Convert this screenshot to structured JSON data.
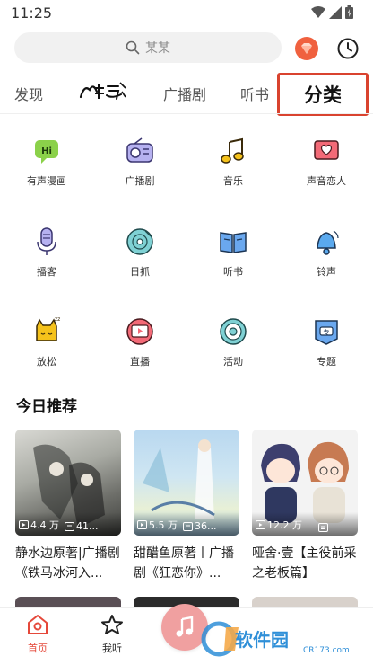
{
  "status_bar": {
    "time": "11:25"
  },
  "header": {
    "search_placeholder": "某某",
    "icons": [
      "search-icon",
      "vip-gem-icon",
      "history-clock-icon"
    ]
  },
  "tabs": [
    {
      "label": "发现"
    },
    {
      "label": "情绘",
      "is_logo": true
    },
    {
      "label": "广播剧"
    },
    {
      "label": "听书"
    },
    {
      "label": "分类",
      "active": true
    }
  ],
  "categories": [
    {
      "label": "有声漫画",
      "icon": "hi-bubble-icon"
    },
    {
      "label": "广播剧",
      "icon": "radio-icon"
    },
    {
      "label": "音乐",
      "icon": "music-note-icon"
    },
    {
      "label": "声音恋人",
      "icon": "heart-envelope-icon"
    },
    {
      "label": "播客",
      "icon": "microphone-icon"
    },
    {
      "label": "日抓",
      "icon": "disc-icon"
    },
    {
      "label": "听书",
      "icon": "open-book-icon"
    },
    {
      "label": "铃声",
      "icon": "bell-icon"
    },
    {
      "label": "放松",
      "icon": "sleepy-cat-icon"
    },
    {
      "label": "直播",
      "icon": "live-play-icon"
    },
    {
      "label": "活动",
      "icon": "target-activity-icon"
    },
    {
      "label": "专题",
      "icon": "topic-badge-icon"
    }
  ],
  "section": {
    "title": "今日推荐"
  },
  "recommendations": [
    {
      "plays": "4.4 万",
      "comments": "41...",
      "title": "静水边原著|广播剧《铁马冰河入..."
    },
    {
      "plays": "5.5 万",
      "comments": "36...",
      "title": "甜醋鱼原著丨广播剧《狂恋你》..."
    },
    {
      "plays": "12.2 万",
      "comments": "",
      "title": "哑舍·壹【主役前采之老板篇】"
    }
  ],
  "bottom_nav": [
    {
      "label": "首页",
      "active": true,
      "icon": "home-icon"
    },
    {
      "label": "我听",
      "icon": "star-icon"
    }
  ],
  "watermark": {
    "main": "软件园",
    "sub": "CR173.com"
  },
  "colors": {
    "accent": "#e5483a",
    "active_tab_border": "#d9432f"
  }
}
